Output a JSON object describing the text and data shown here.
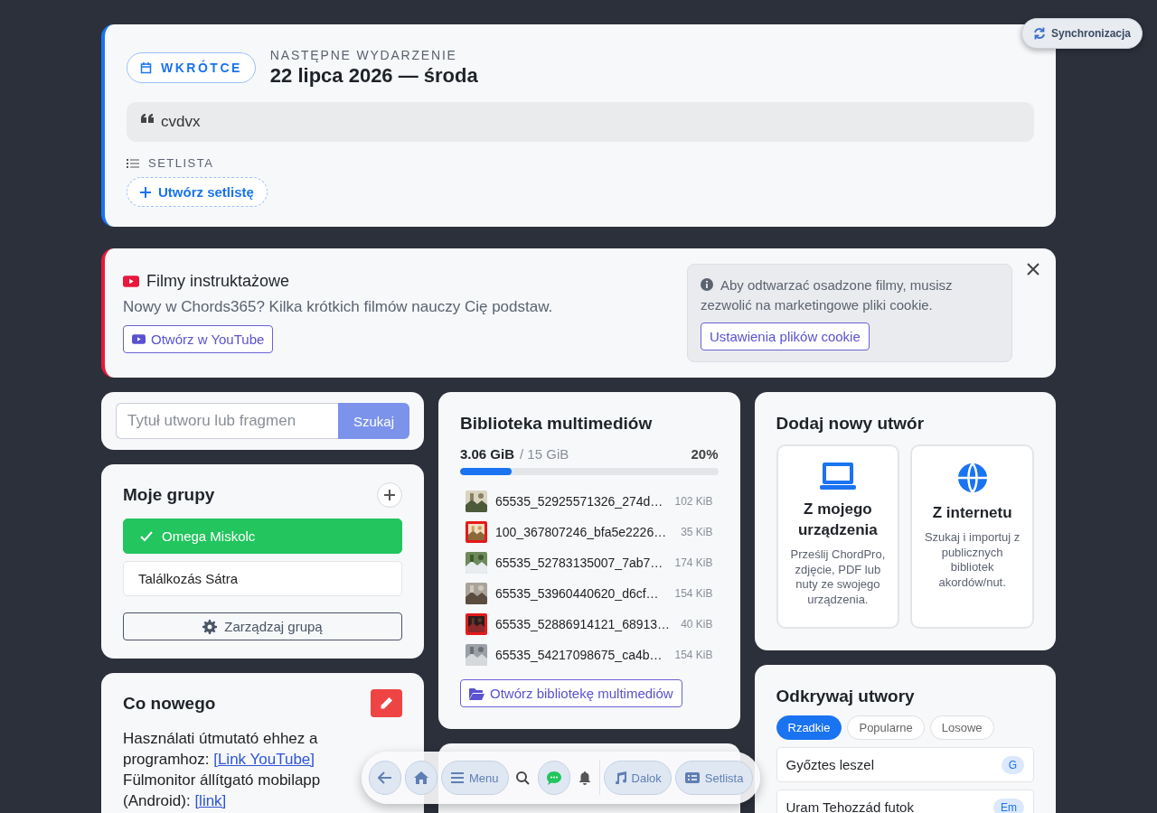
{
  "sync_button": {
    "label": "Synchronizacja"
  },
  "event": {
    "badge": "WKRÓTCE",
    "eyebrow": "NASTĘPNE WYDARZENIE",
    "date": "22 lipca 2026 — środa",
    "note": "cvdvx",
    "setlist_label": "SETLISTA",
    "create_setlist": "Utwórz setlistę"
  },
  "videos": {
    "title": "Filmy instruktażowe",
    "subtitle": "Nowy w Chords365? Kilka krótkich filmów nauczy Cię podstaw.",
    "open_button": "Otwórz w YouTube",
    "cookie_notice": "Aby odtwarzać osadzone filmy, musisz zezwolić na marketingowe pliki cookie.",
    "cookie_button": "Ustawienia plików cookie"
  },
  "search": {
    "placeholder": "Tytuł utworu lub fragmen",
    "button": "Szukaj"
  },
  "groups": {
    "title": "Moje grupy",
    "items": [
      {
        "name": "Omega Miskolc",
        "selected": true
      },
      {
        "name": "Találkozás Sátra",
        "selected": false
      }
    ],
    "manage_button": "Zarządzaj grupą"
  },
  "whats_new": {
    "title": "Co nowego",
    "lines": [
      {
        "text": "Használati útmutató ehhez a programhoz:",
        "link": "[Link YouTube]"
      },
      {
        "text": "Fülmonitor állítgató mobilapp (Android):",
        "link": "[link]"
      }
    ]
  },
  "media": {
    "title": "Biblioteka multimediów",
    "used": "3.06 GiB",
    "total": "/ 15 GiB",
    "percent": "20%",
    "level": 0.2,
    "files": [
      {
        "name": "65535_52925571326_274d…",
        "size": "102 KiB",
        "framed": false
      },
      {
        "name": "100_367807246_bfa5e2226…",
        "size": "35 KiB",
        "framed": true
      },
      {
        "name": "65535_52783135007_7ab7…",
        "size": "174 KiB",
        "framed": false
      },
      {
        "name": "65535_53960440620_d6cf…",
        "size": "154 KiB",
        "framed": false
      },
      {
        "name": "65535_52886914121_68913…",
        "size": "40 KiB",
        "framed": true
      },
      {
        "name": "65535_54217098675_ca4b…",
        "size": "154 KiB",
        "framed": false
      }
    ],
    "open_button": "Otwórz bibliotekę multimediów"
  },
  "add_song": {
    "title": "Dodaj nowy utwór",
    "options": [
      {
        "kind": "device",
        "title": "Z mojego urządzenia",
        "description": "Prześlij ChordPro, zdjęcie, PDF lub nuty ze swojego urządzenia."
      },
      {
        "kind": "web",
        "title": "Z internetu",
        "description": "Szukaj i importuj z publicznych bibliotek akordów/nut."
      }
    ]
  },
  "discover": {
    "title": "Odkrywaj utwory",
    "filters": [
      {
        "label": "Rzadkie",
        "selected": true
      },
      {
        "label": "Popularne",
        "selected": false
      },
      {
        "label": "Losowe",
        "selected": false
      }
    ],
    "songs": [
      {
        "title": "Győztes leszel",
        "key": "G"
      },
      {
        "title": "Uram Tehozzád futok",
        "key": "Em"
      }
    ]
  },
  "toolbar": {
    "items": [
      {
        "kind": "back"
      },
      {
        "kind": "home"
      },
      {
        "kind": "menu",
        "label": "Menu"
      },
      {
        "kind": "search"
      },
      {
        "kind": "chat"
      },
      {
        "kind": "bell"
      },
      {
        "kind": "songs",
        "label": "Dalok"
      },
      {
        "kind": "setlist",
        "label": "Setlista"
      }
    ]
  }
}
